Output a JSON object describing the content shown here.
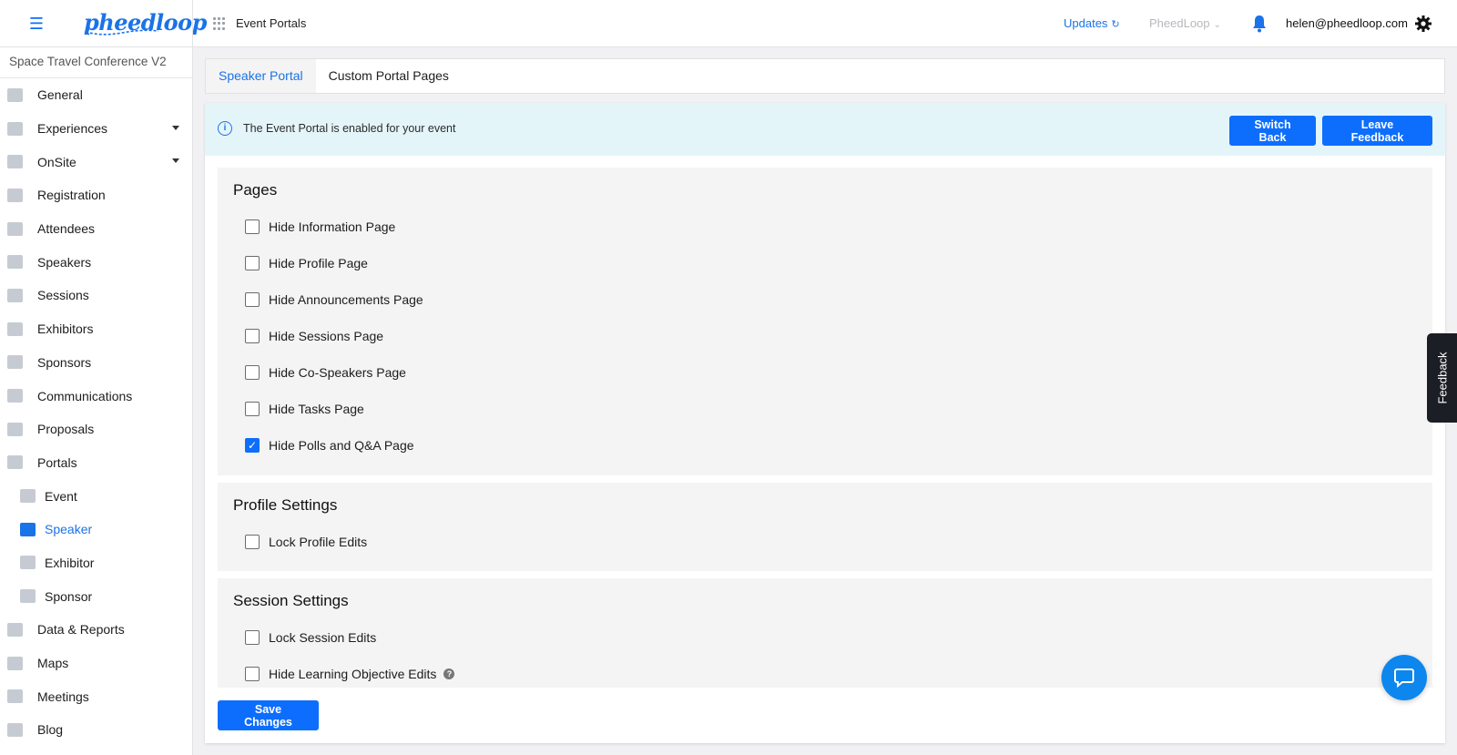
{
  "topbar": {
    "menu_icon": "hamburger-icon",
    "logo_text": "pheedloop",
    "breadcrumb": "Event Portals",
    "updates_label": "Updates",
    "org_label": "PheedLoop",
    "user_email": "helen@pheedloop.com",
    "accent_color": "#1a73e8"
  },
  "sidebar": {
    "event_name": "Space Travel Conference V2",
    "items": [
      {
        "label": "General",
        "icon": "grid-icon"
      },
      {
        "label": "Experiences",
        "icon": "person-icon",
        "expandable": true
      },
      {
        "label": "OnSite",
        "icon": "printer-icon",
        "expandable": true
      },
      {
        "label": "Registration",
        "icon": "cart-icon"
      },
      {
        "label": "Attendees",
        "icon": "people-icon"
      },
      {
        "label": "Speakers",
        "icon": "presenter-icon"
      },
      {
        "label": "Sessions",
        "icon": "screen-icon"
      },
      {
        "label": "Exhibitors",
        "icon": "store-icon"
      },
      {
        "label": "Sponsors",
        "icon": "badge-icon"
      },
      {
        "label": "Communications",
        "icon": "mail-icon"
      },
      {
        "label": "Proposals",
        "icon": "document-icon"
      },
      {
        "label": "Portals",
        "icon": "globe-icon"
      },
      {
        "label": "Event",
        "icon": "video-icon",
        "sub": true
      },
      {
        "label": "Speaker",
        "icon": "presenter-icon",
        "sub": true,
        "active": true
      },
      {
        "label": "Exhibitor",
        "icon": "store-icon",
        "sub": true
      },
      {
        "label": "Sponsor",
        "icon": "badge-icon",
        "sub": true
      },
      {
        "label": "Data & Reports",
        "icon": "chart-icon"
      },
      {
        "label": "Maps",
        "icon": "map-icon"
      },
      {
        "label": "Meetings",
        "icon": "calendar-icon"
      },
      {
        "label": "Blog",
        "icon": "document-icon"
      }
    ]
  },
  "tabs": [
    {
      "label": "Speaker Portal",
      "active": true
    },
    {
      "label": "Custom Portal Pages",
      "active": false
    }
  ],
  "banner": {
    "text": "The Event Portal is enabled for your event",
    "switch_back": "Switch Back",
    "leave_feedback": "Leave Feedback"
  },
  "sections": {
    "pages": {
      "title": "Pages",
      "options": [
        {
          "label": "Hide Information Page",
          "checked": false
        },
        {
          "label": "Hide Profile Page",
          "checked": false
        },
        {
          "label": "Hide Announcements Page",
          "checked": false
        },
        {
          "label": "Hide Sessions Page",
          "checked": false
        },
        {
          "label": "Hide Co-Speakers Page",
          "checked": false
        },
        {
          "label": "Hide Tasks Page",
          "checked": false
        },
        {
          "label": "Hide Polls and Q&A Page",
          "checked": true
        }
      ]
    },
    "profile": {
      "title": "Profile Settings",
      "options": [
        {
          "label": "Lock Profile Edits",
          "checked": false
        }
      ]
    },
    "session": {
      "title": "Session Settings",
      "options": [
        {
          "label": "Lock Session Edits",
          "checked": false
        },
        {
          "label": "Hide Learning Objective Edits",
          "checked": false,
          "help": true
        }
      ]
    }
  },
  "save_label": "Save Changes",
  "feedback_tab": "Feedback"
}
